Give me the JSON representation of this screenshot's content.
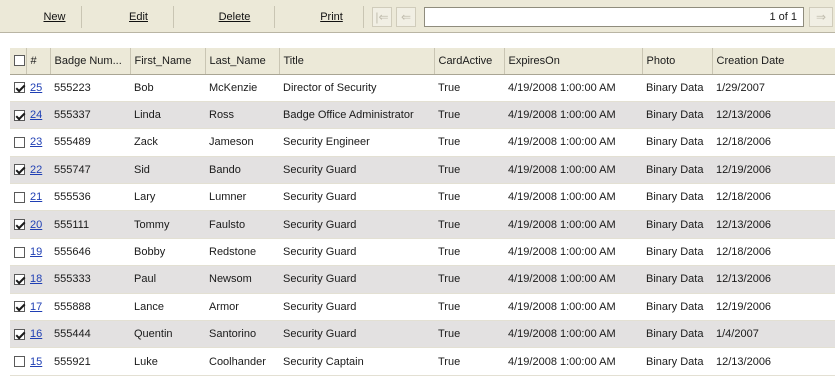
{
  "toolbar": {
    "new_label": "New",
    "edit_label": "Edit",
    "delete_label": "Delete",
    "print_label": "Print",
    "first_icon": "first-page-icon",
    "prev_icon": "prev-page-icon",
    "next_icon": "next-page-icon",
    "page_indicator": "1 of 1"
  },
  "grid": {
    "columns": [
      "",
      "#",
      "Badge Num...",
      "First_Name",
      "Last_Name",
      "Title",
      "CardActive",
      "ExpiresOn",
      "Photo",
      "Creation Date"
    ],
    "rows": [
      {
        "checked": true,
        "id": "25",
        "badge": "555223",
        "first": "Bob",
        "last": "McKenzie",
        "title": "Director of Security",
        "active": "True",
        "expires": "4/19/2008 1:00:00 AM",
        "photo": "Binary Data",
        "created": "1/29/2007"
      },
      {
        "checked": true,
        "id": "24",
        "badge": "555337",
        "first": "Linda",
        "last": "Ross",
        "title": "Badge Office Administrator",
        "active": "True",
        "expires": "4/19/2008 1:00:00 AM",
        "photo": "Binary Data",
        "created": "12/13/2006"
      },
      {
        "checked": false,
        "id": "23",
        "badge": "555489",
        "first": "Zack",
        "last": "Jameson",
        "title": "Security Engineer",
        "active": "True",
        "expires": "4/19/2008 1:00:00 AM",
        "photo": "Binary Data",
        "created": "12/18/2006"
      },
      {
        "checked": true,
        "id": "22",
        "badge": "555747",
        "first": "Sid",
        "last": "Bando",
        "title": "Security Guard",
        "active": "True",
        "expires": "4/19/2008 1:00:00 AM",
        "photo": "Binary Data",
        "created": "12/19/2006"
      },
      {
        "checked": false,
        "id": "21",
        "badge": "555536",
        "first": "Lary",
        "last": "Lumner",
        "title": "Security Guard",
        "active": "True",
        "expires": "4/19/2008 1:00:00 AM",
        "photo": "Binary Data",
        "created": "12/18/2006"
      },
      {
        "checked": true,
        "id": "20",
        "badge": "555111",
        "first": "Tommy",
        "last": "Faulsto",
        "title": "Security Guard",
        "active": "True",
        "expires": "4/19/2008 1:00:00 AM",
        "photo": "Binary Data",
        "created": "12/13/2006"
      },
      {
        "checked": false,
        "id": "19",
        "badge": "555646",
        "first": "Bobby",
        "last": "Redstone",
        "title": "Security Guard",
        "active": "True",
        "expires": "4/19/2008 1:00:00 AM",
        "photo": "Binary Data",
        "created": "12/18/2006"
      },
      {
        "checked": true,
        "id": "18",
        "badge": "555333",
        "first": "Paul",
        "last": "Newsom",
        "title": "Security Guard",
        "active": "True",
        "expires": "4/19/2008 1:00:00 AM",
        "photo": "Binary Data",
        "created": "12/13/2006"
      },
      {
        "checked": true,
        "id": "17",
        "badge": "555888",
        "first": "Lance",
        "last": "Armor",
        "title": "Security Guard",
        "active": "True",
        "expires": "4/19/2008 1:00:00 AM",
        "photo": "Binary Data",
        "created": "12/19/2006"
      },
      {
        "checked": true,
        "id": "16",
        "badge": "555444",
        "first": "Quentin",
        "last": "Santorino",
        "title": "Security Guard",
        "active": "True",
        "expires": "4/19/2008 1:00:00 AM",
        "photo": "Binary Data",
        "created": "1/4/2007"
      },
      {
        "checked": false,
        "id": "15",
        "badge": "555921",
        "first": "Luke",
        "last": "Coolhander",
        "title": "Security Captain",
        "active": "True",
        "expires": "4/19/2008 1:00:00 AM",
        "photo": "Binary Data",
        "created": "12/13/2006"
      }
    ]
  }
}
